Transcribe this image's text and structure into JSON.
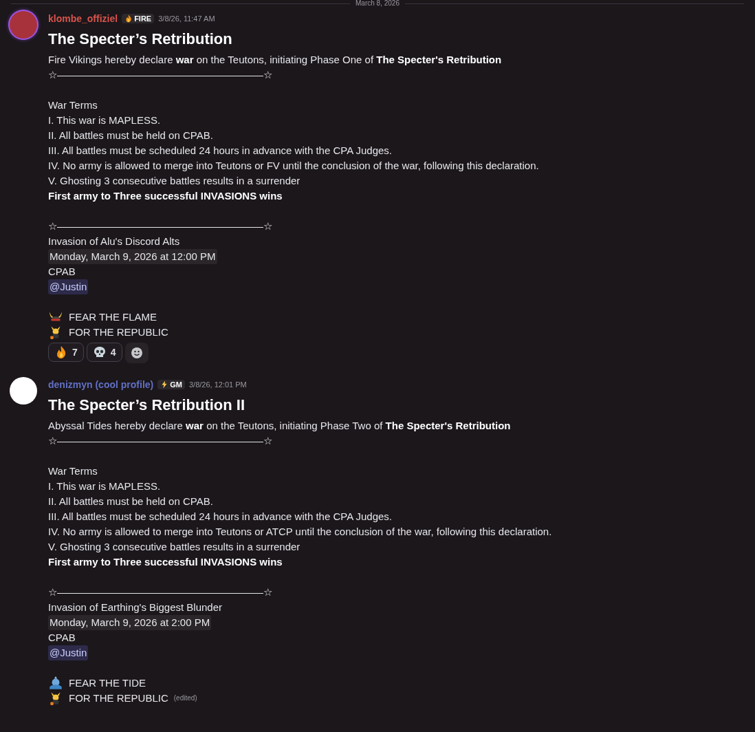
{
  "date_divider": "March 8, 2026",
  "messages": [
    {
      "author": "klombe_offiziel",
      "color": "#d9534b",
      "tag": {
        "kind": "flame",
        "label": "FIRE"
      },
      "time": "3/8/26, 11:47 AM",
      "title": "The Specter’s Retribution",
      "lines": [
        {
          "kind": "text",
          "text": "Fire Vikings hereby declare **war** on the Teutons, initiating Phase One of **The Specter's Retribution**"
        },
        {
          "kind": "text",
          "text": "☆————————————————————☆"
        },
        {
          "kind": "blank"
        },
        {
          "kind": "text",
          "text": "War Terms"
        },
        {
          "kind": "text",
          "text": "I. This war is MAPLESS."
        },
        {
          "kind": "text",
          "text": "II. All battles must be held on CPAB."
        },
        {
          "kind": "text",
          "text": "III. All battles must be scheduled 24 hours in advance with the CPA Judges."
        },
        {
          "kind": "text",
          "text": "IV. No army is allowed to merge into Teutons or FV until the conclusion of the war, following this declaration."
        },
        {
          "kind": "text",
          "text": "V. Ghosting 3 consecutive battles results in a surrender"
        },
        {
          "kind": "bold",
          "text": "First army to Three successful INVASIONS wins"
        },
        {
          "kind": "blank"
        },
        {
          "kind": "text",
          "text": "☆————————————————————☆"
        },
        {
          "kind": "text",
          "text": "Invasion of Alu's Discord Alts"
        },
        {
          "kind": "timestamp",
          "text": "Monday, March 9, 2026 at 12:00 PM"
        },
        {
          "kind": "text",
          "text": "CPAB"
        },
        {
          "kind": "mention",
          "text": "@Justin"
        },
        {
          "kind": "blank"
        },
        {
          "kind": "emoji-horns",
          "text": "FEAR THE FLAME"
        },
        {
          "kind": "emoji-duck",
          "text": "FOR THE REPUBLIC"
        }
      ],
      "reactions": [
        {
          "kind": "flame",
          "count": "7"
        },
        {
          "kind": "skull",
          "count": "4"
        }
      ]
    },
    {
      "author": "denizmyn (cool profile)",
      "color": "#6270c4",
      "tag": {
        "kind": "bolt",
        "label": "GM"
      },
      "time": "3/8/26, 12:01 PM",
      "title": "The Specter’s Retribution II",
      "lines": [
        {
          "kind": "text",
          "text": "Abyssal Tides hereby declare **war** on the Teutons, initiating Phase Two of **The Specter's Retribution**"
        },
        {
          "kind": "text",
          "text": "☆————————————————————☆"
        },
        {
          "kind": "blank"
        },
        {
          "kind": "text",
          "text": "War Terms"
        },
        {
          "kind": "text",
          "text": "I. This war is MAPLESS."
        },
        {
          "kind": "text",
          "text": "II. All battles must be held on CPAB."
        },
        {
          "kind": "text",
          "text": "III. All battles must be scheduled 24 hours in advance with the CPA Judges."
        },
        {
          "kind": "text",
          "text": "IV. No army is allowed to merge into Teutons or ATCP until the conclusion of the war, following this declaration."
        },
        {
          "kind": "text",
          "text": "V. Ghosting 3 consecutive battles results in a surrender"
        },
        {
          "kind": "bold",
          "text": "First army to Three successful INVASIONS wins"
        },
        {
          "kind": "blank"
        },
        {
          "kind": "text",
          "text": "☆————————————————————☆"
        },
        {
          "kind": "text",
          "text": "Invasion of Earthing's Biggest Blunder"
        },
        {
          "kind": "timestamp",
          "text": "Monday, March 9, 2026 at 2:00 PM"
        },
        {
          "kind": "text",
          "text": "CPAB"
        },
        {
          "kind": "mention",
          "text": "@Justin"
        },
        {
          "kind": "blank"
        },
        {
          "kind": "emoji-wave",
          "text": "FEAR THE TIDE"
        },
        {
          "kind": "emoji-duck",
          "text": "FOR THE REPUBLIC",
          "edited": "(edited)"
        }
      ]
    }
  ]
}
